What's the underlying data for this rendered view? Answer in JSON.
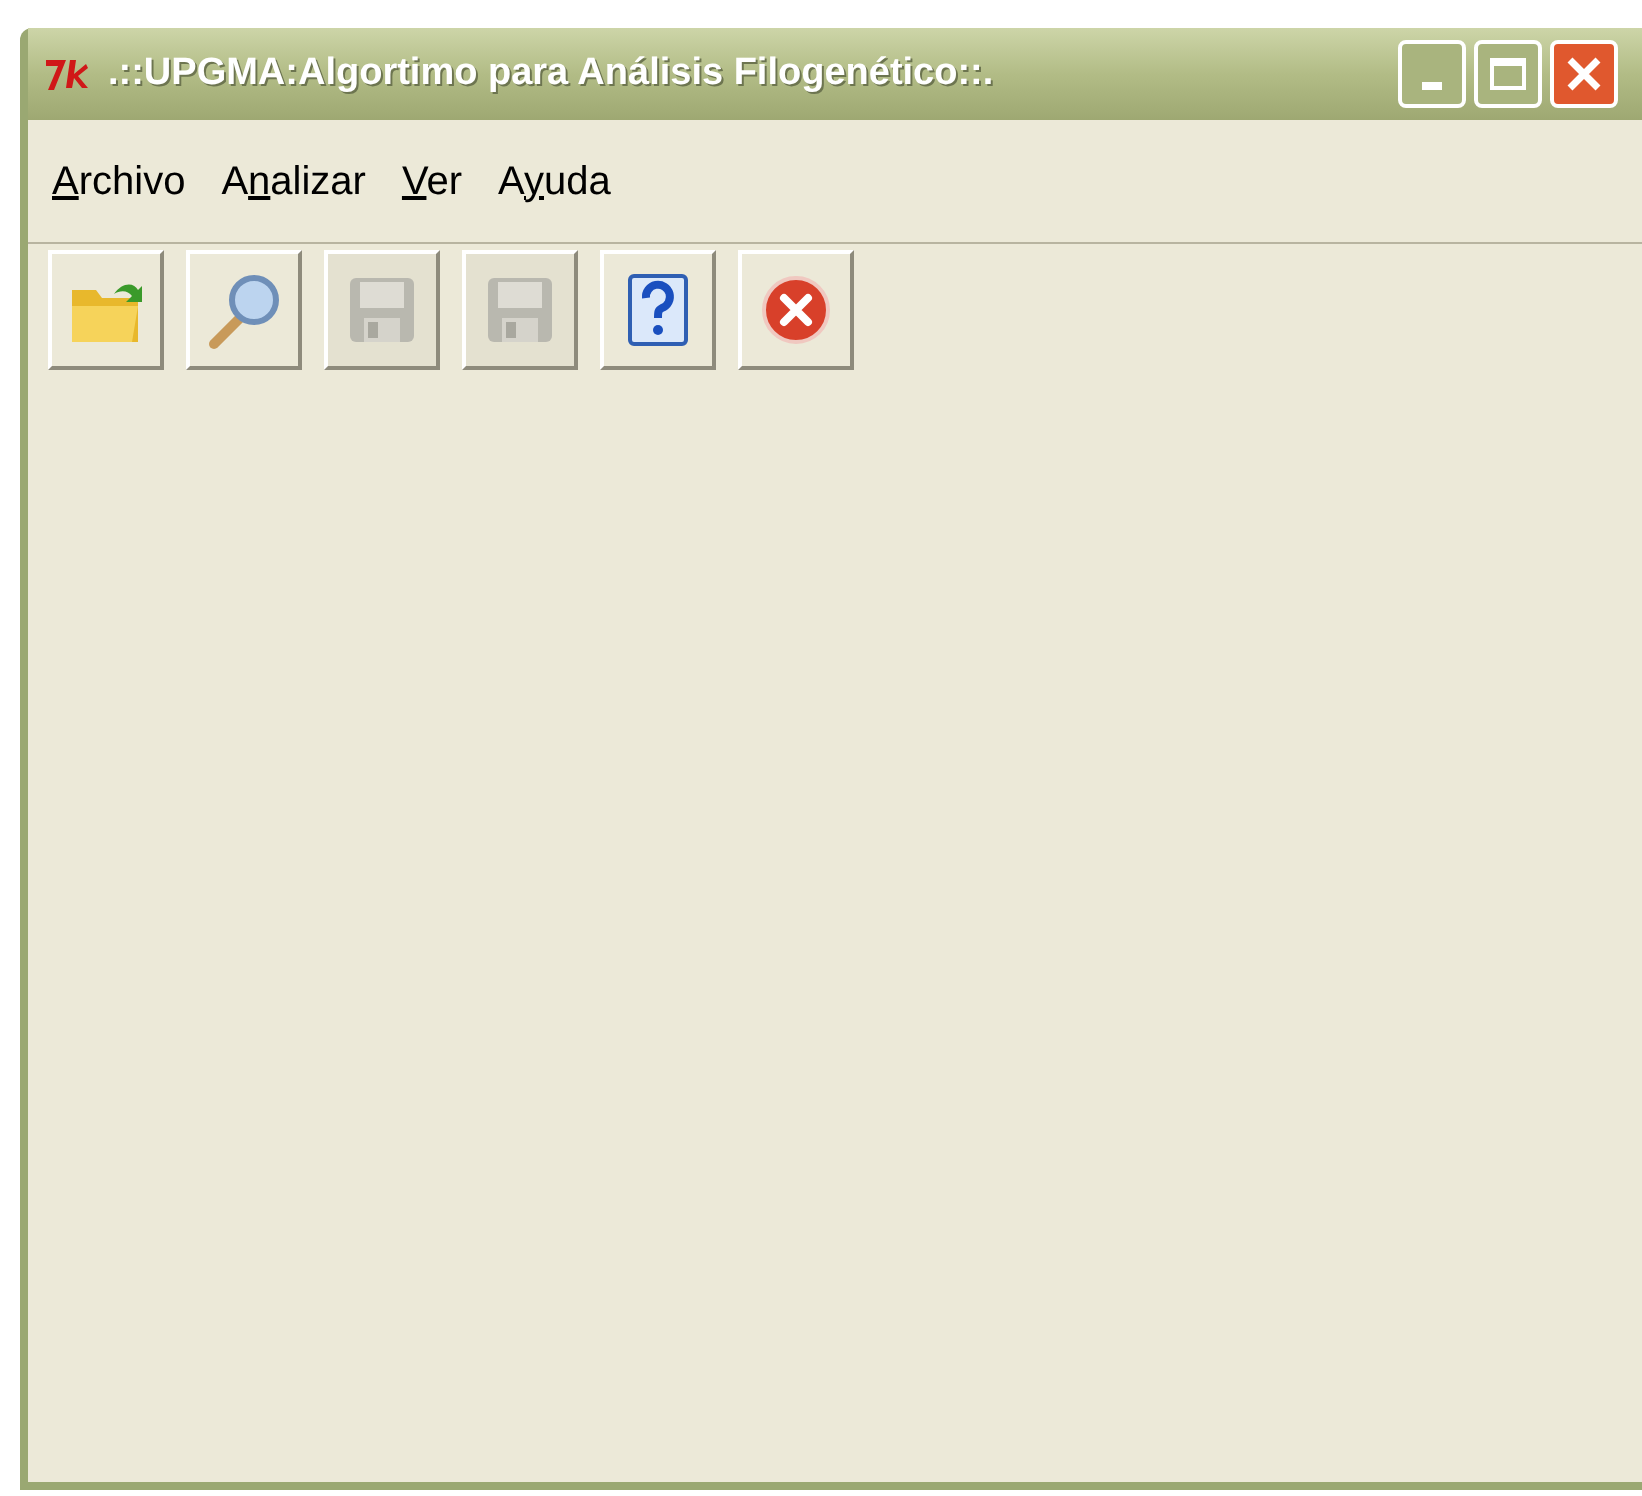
{
  "window": {
    "title": ".::UPGMA:Algortimo para Análisis Filogenético::."
  },
  "menu": [
    {
      "key": "A",
      "tail": "rchivo"
    },
    {
      "lead": "A",
      "key": "n",
      "tail": "alizar"
    },
    {
      "key": "V",
      "tail": "er"
    },
    {
      "lead": "A",
      "key": "y",
      "tail": "uda"
    }
  ],
  "toolbar": [
    {
      "kind": "open",
      "disabled": false
    },
    {
      "kind": "search",
      "disabled": false
    },
    {
      "kind": "save",
      "disabled": true
    },
    {
      "kind": "save-as",
      "disabled": true
    },
    {
      "kind": "help",
      "disabled": false
    },
    {
      "kind": "exit",
      "disabled": false
    }
  ]
}
